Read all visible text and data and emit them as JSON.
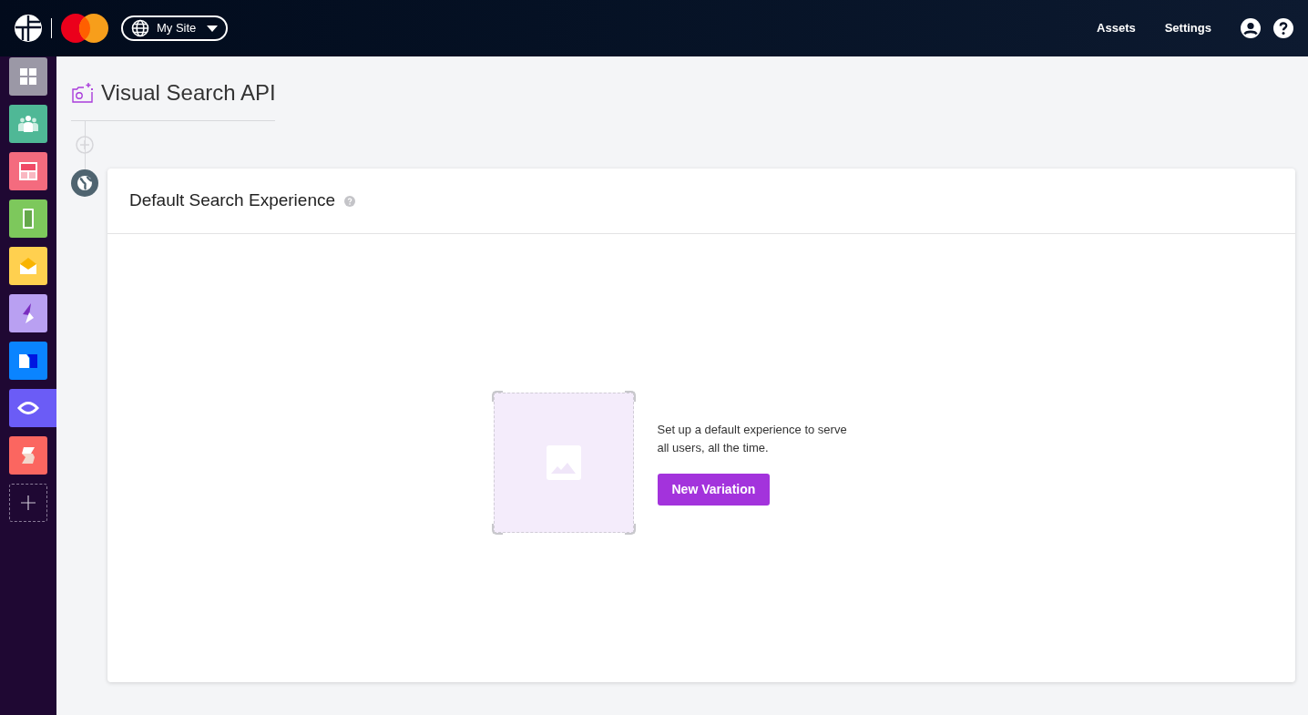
{
  "header": {
    "site": "My Site",
    "nav": [
      "Assets",
      "Settings"
    ]
  },
  "sidebar": {
    "apps": [
      {
        "kind": "grid",
        "color": "#9b98a6",
        "selected": false
      },
      {
        "kind": "people",
        "color": "#4fb896",
        "selected": false
      },
      {
        "kind": "layout",
        "color": "#f46b7e",
        "selected": false
      },
      {
        "kind": "phone",
        "color": "#7dc85c",
        "selected": false
      },
      {
        "kind": "mail",
        "color": "#ffd04f",
        "selected": false
      },
      {
        "kind": "bolt",
        "color": "#b9a0f2",
        "selected": false
      },
      {
        "kind": "blocks",
        "color": "#0a84ff",
        "selected": false
      },
      {
        "kind": "eye",
        "color": "#6b5cf6",
        "selected": true
      },
      {
        "kind": "stripes",
        "color": "#fb6660",
        "selected": false
      }
    ]
  },
  "page": {
    "title": "Visual Search API"
  },
  "card": {
    "title": "Default Search Experience",
    "message": "Set up a default experience to serve all users, all the time.",
    "button": "New Variation"
  }
}
